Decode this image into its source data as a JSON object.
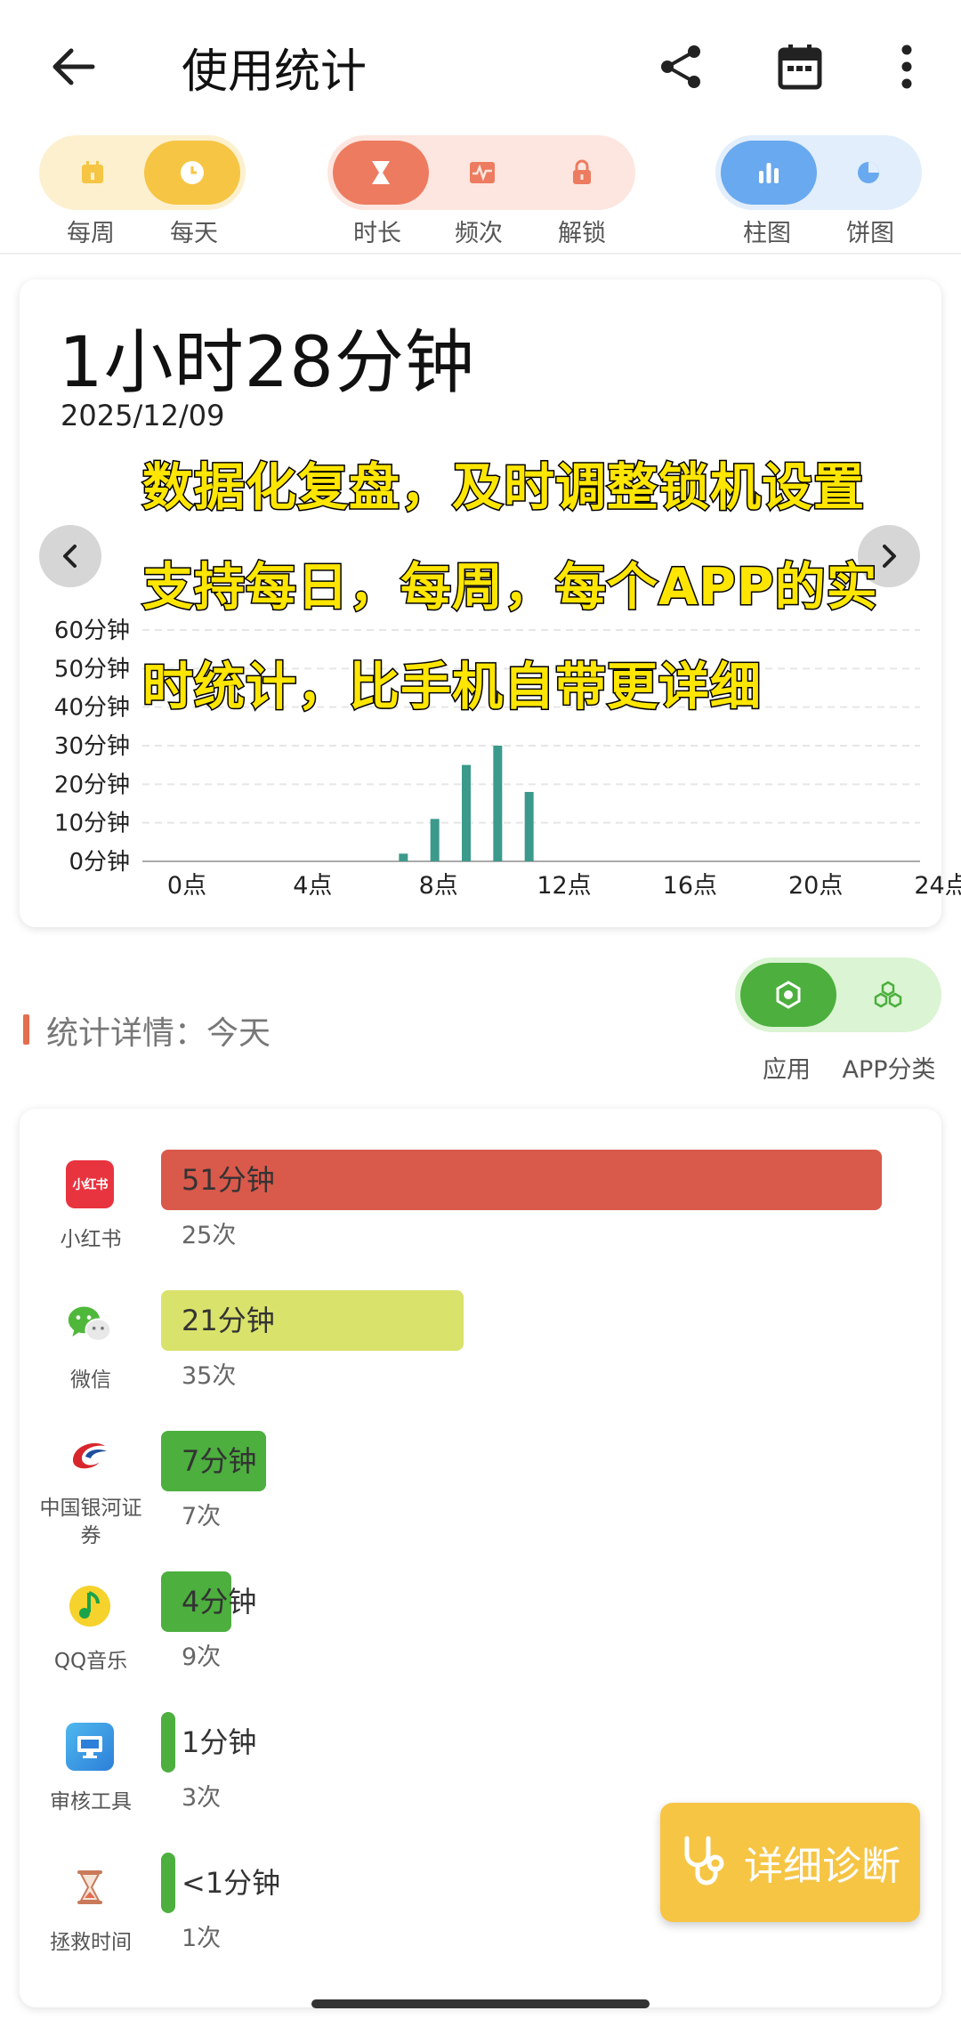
{
  "app_bar": {
    "title": "使用统计"
  },
  "period_toggle": {
    "options": [
      "每周",
      "每天"
    ],
    "selected": "每天"
  },
  "metric_toggle": {
    "options": [
      "时长",
      "频次",
      "解锁"
    ],
    "selected": "时长"
  },
  "chart_toggle": {
    "options": [
      "柱图",
      "饼图"
    ],
    "selected": "柱图"
  },
  "summary": {
    "total": "1小时28分钟",
    "date": "2025/12/09"
  },
  "overlay_lines": [
    "数据化复盘，及时调整锁机设置",
    "支持每日，每周，每个APP的实",
    "时统计，比手机自带更详细"
  ],
  "chart_data": {
    "type": "bar",
    "x": [
      0,
      1,
      2,
      3,
      4,
      5,
      6,
      7,
      8,
      9,
      10,
      11,
      12,
      13,
      14,
      15,
      16,
      17,
      18,
      19,
      20,
      21,
      22,
      23
    ],
    "values": [
      0,
      0,
      0,
      0,
      0,
      0,
      2,
      11,
      25,
      30,
      18,
      0,
      0,
      0,
      0,
      0,
      0,
      0,
      0,
      0,
      0,
      0,
      0,
      0
    ],
    "ylim": [
      0,
      60
    ],
    "y_ticks": [
      "0分钟",
      "10分钟",
      "20分钟",
      "30分钟",
      "40分钟",
      "50分钟",
      "60分钟"
    ],
    "x_ticks": [
      "0点",
      "4点",
      "8点",
      "12点",
      "16点",
      "20点",
      "24点"
    ],
    "grid": true,
    "color": "#3b9a8b"
  },
  "stats": {
    "title": "统计详情：今天"
  },
  "view_toggle": {
    "options": [
      "应用",
      "APP分类"
    ],
    "selected": "应用"
  },
  "apps": [
    {
      "name": "小红书",
      "duration": "51分钟",
      "count": "25次",
      "fraction": 1.0,
      "color": "#d9594b",
      "icon_text": "小红书"
    },
    {
      "name": "微信",
      "duration": "21分钟",
      "count": "35次",
      "fraction": 0.42,
      "color": "#d9e26a"
    },
    {
      "name": "中国银河证券",
      "duration": "7分钟",
      "count": "7次",
      "fraction": 0.146,
      "color": "#4caf3e"
    },
    {
      "name": "QQ音乐",
      "duration": "4分钟",
      "count": "9次",
      "fraction": 0.098,
      "color": "#4caf3e"
    },
    {
      "name": "审核工具",
      "duration": "1分钟",
      "count": "3次",
      "fraction": 0.02,
      "color": "#4caf3e"
    },
    {
      "name": "拯救时间",
      "duration": "<1分钟",
      "count": "1次",
      "fraction": 0.016,
      "color": "#4caf3e"
    }
  ],
  "fab": {
    "label": "详细诊断"
  }
}
